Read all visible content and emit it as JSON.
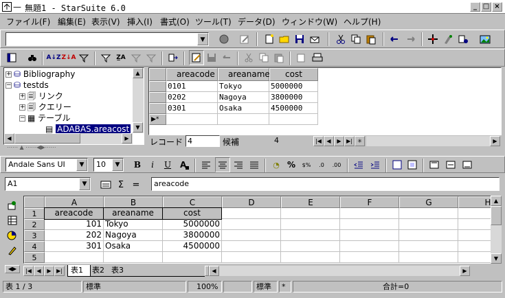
{
  "window": {
    "title": "無題1 - StarSuite 6.0"
  },
  "menu": [
    "ファイル(F)",
    "編集(E)",
    "表示(V)",
    "挿入(I)",
    "書式(O)",
    "ツール(T)",
    "データ(D)",
    "ウィンドウ(W)",
    "ヘルプ(H)"
  ],
  "tree": {
    "items": [
      {
        "label": "Bibliography"
      },
      {
        "label": "testds"
      },
      {
        "label": "リンク"
      },
      {
        "label": "クエリー"
      },
      {
        "label": "テーブル"
      },
      {
        "label": "ADABAS.areacost"
      }
    ]
  },
  "datagrid": {
    "columns": [
      "areacode",
      "areaname",
      "cost"
    ],
    "rows": [
      [
        "0101",
        "Tokyo",
        "5000000"
      ],
      [
        "0202",
        "Nagoya",
        "3800000"
      ],
      [
        "0301",
        "Osaka",
        "4500000"
      ]
    ],
    "new_row_marker": "▶*"
  },
  "recordbar": {
    "label": "レコード",
    "value": "4",
    "candidate_label": "候補",
    "candidate_value": "4"
  },
  "format": {
    "font": "Andale Sans UI",
    "size": "10"
  },
  "formula": {
    "cellref": "A1",
    "sum_symbol": "Σ",
    "eq_symbol": "=",
    "content": "areacode"
  },
  "sheet": {
    "columns": [
      "A",
      "B",
      "C",
      "D",
      "E",
      "F",
      "G",
      "H"
    ],
    "rows": [
      "1",
      "2",
      "3",
      "4",
      "5"
    ],
    "cells": [
      [
        "areacode",
        "areaname",
        "cost"
      ],
      [
        "101",
        "Tokyo",
        "5000000"
      ],
      [
        "202",
        "Nagoya",
        "3800000"
      ],
      [
        "301",
        "Osaka",
        "4500000"
      ]
    ],
    "tabs": [
      "表1",
      "表2",
      "表3"
    ]
  },
  "status": {
    "sheet": "表 1 / 3",
    "style": "標準",
    "zoom": "100%",
    "mode": "標準",
    "modified": "*",
    "sum": "合計=0"
  }
}
